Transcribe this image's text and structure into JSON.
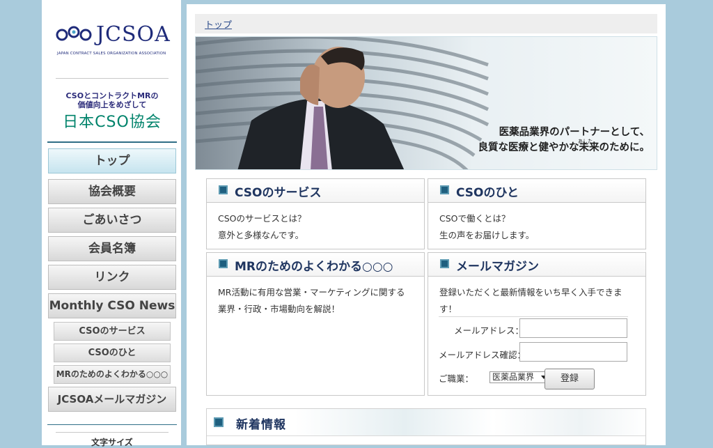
{
  "sidebar": {
    "logo_text": "JCSOA",
    "logo_sub": "JAPAN CONTRACT SALES ORGANIZATION ASSOCIATION",
    "tagline_line1": "CSOとコントラクトMRの",
    "tagline_line2": "価値向上をめざして",
    "site_name": "日本CSO協会",
    "nav": [
      {
        "label": "トップ",
        "active": true
      },
      {
        "label": "協会概要"
      },
      {
        "label": "ごあいさつ"
      },
      {
        "label": "会員名簿"
      },
      {
        "label": "リンク"
      },
      {
        "label": "Monthly CSO News"
      }
    ],
    "subnav": [
      {
        "label": "CSOのサービス"
      },
      {
        "label": "CSOのひと"
      },
      {
        "label": "MRのためのよくわかる○○○"
      }
    ],
    "mail_magazine": "JCSOAメールマガジン",
    "font_size_label": "文字サイズ"
  },
  "breadcrumb": {
    "label": "トップ"
  },
  "hero": {
    "caption_line1": "医薬品業界のパートナーとして、",
    "caption_line2": "良質な医療と健やかな未来のために。",
    "ruby": "あした"
  },
  "cards": {
    "service": {
      "title": "CSOのサービス",
      "line1": "CSOのサービスとは？",
      "line2": "意外と多様なんです。"
    },
    "people": {
      "title": "CSOのひと",
      "line1": "CSOで働くとは？",
      "line2": "生の声をお届けします。"
    },
    "mr": {
      "title": "MRのためのよくわかる○○○",
      "line1": "MR活動に有用な営業・マーケティングに関する",
      "line2": "業界・行政・市場動向を解説！"
    },
    "mail": {
      "title": "メールマガジン",
      "line1": "登録いただくと最新情報をいち早く入手できま",
      "line2": "す！",
      "email_label": "メールアドレス：",
      "email_confirm_label": "メールアドレス確認：",
      "email_value": "",
      "email_confirm_value": "",
      "job_label": "ご職業：",
      "job_selected": "医薬品業界",
      "submit_label": "登録"
    }
  },
  "news": {
    "title": "新着情報"
  },
  "colors": {
    "background": "#a9cbdc",
    "accent": "#1f5f7f",
    "site_name": "#00836b"
  }
}
